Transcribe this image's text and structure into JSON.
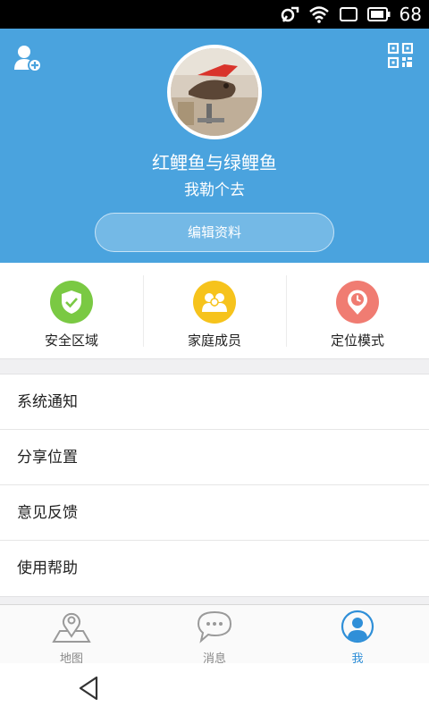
{
  "status_bar": {
    "battery_level": "68",
    "battery_icon": "battery-icon",
    "wifi_icon": "wifi-icon",
    "signal_icon": "signal-icon"
  },
  "header": {
    "background_color": "#4aa3de",
    "username": "红鲤鱼与绿鲤鱼",
    "signature": "我勒个去",
    "edit_label": "编辑资料",
    "add_friend_icon": "add-friend-icon",
    "qr_icon": "qr-code-icon"
  },
  "features": [
    {
      "label": "安全区域",
      "icon": "shield-check-icon",
      "color": "#7ac943"
    },
    {
      "label": "家庭成员",
      "icon": "family-members-icon",
      "color": "#f6c31c"
    },
    {
      "label": "定位模式",
      "icon": "location-clock-icon",
      "color": "#f07c72"
    }
  ],
  "menu": [
    {
      "label": "系统通知"
    },
    {
      "label": "分享位置"
    },
    {
      "label": "意见反馈"
    },
    {
      "label": "使用帮助"
    }
  ],
  "tabs": [
    {
      "label": "地图",
      "icon": "map-pin-icon"
    },
    {
      "label": "消息",
      "icon": "chat-bubble-icon"
    },
    {
      "label": "我",
      "icon": "user-profile-icon",
      "active": true
    }
  ],
  "colors": {
    "accent": "#2f8fd8"
  }
}
